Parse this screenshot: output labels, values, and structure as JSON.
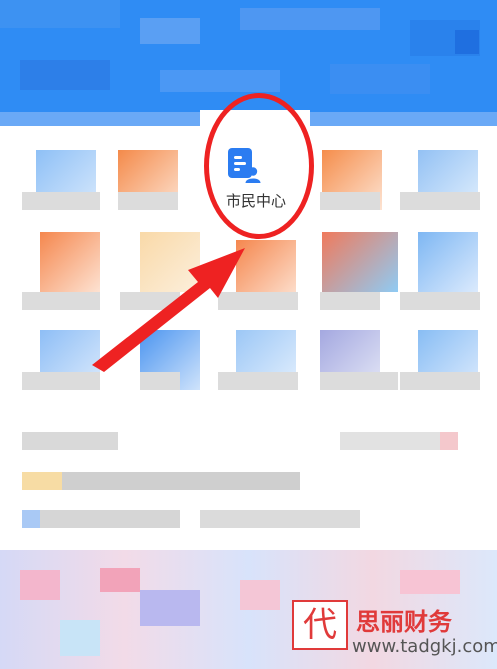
{
  "feature_tile": {
    "label": "市民中心",
    "icon": "citizen-document-person-icon"
  },
  "annotation": {
    "shape": "ellipse",
    "color": "#ee2222",
    "arrow_direction": "up-right"
  },
  "watermark": {
    "name": "思丽财务",
    "url": "www.tadgkj.com",
    "logo_glyph": "代",
    "color": "#e03a3a"
  },
  "colors": {
    "header": "#2f8cf4",
    "accent_blue": "#2b7cf1",
    "annotation_red": "#ee2222"
  }
}
